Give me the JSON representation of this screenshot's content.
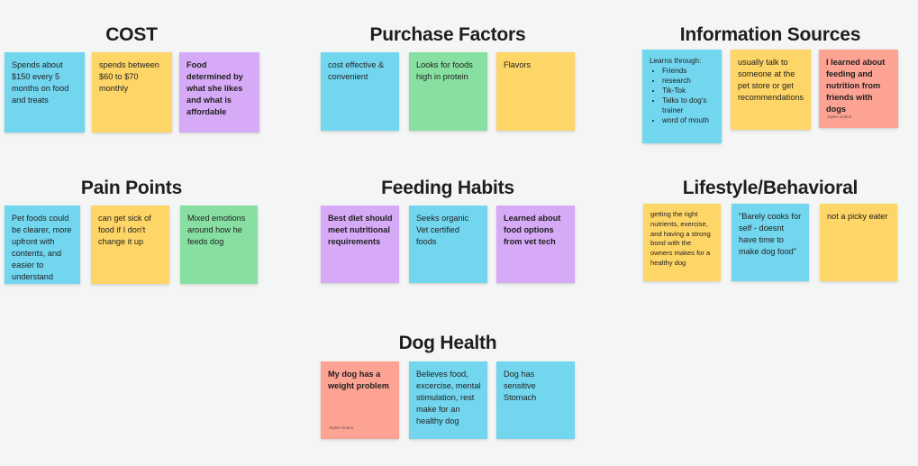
{
  "clusters": {
    "cost": {
      "title": "COST",
      "notes": [
        {
          "text": "Spends about $150 every 5 months on food and treats"
        },
        {
          "text": "spends between $60 to $70 monthly"
        },
        {
          "text": "Food determined by what she likes and what is affordable"
        }
      ]
    },
    "purchase_factors": {
      "title": "Purchase Factors",
      "notes": [
        {
          "text": "cost effective & convenient"
        },
        {
          "text": "Looks for foods high in protein"
        },
        {
          "text": "Flavors"
        }
      ]
    },
    "information_sources": {
      "title": "Information Sources",
      "notes": [
        {
          "intro": "Learns through:",
          "items": [
            "Friends",
            "research",
            "Tik-Tok",
            "Talks to dog's trainer",
            "word of mouth"
          ]
        },
        {
          "text": "usually talk to someone at the pet store or get recommendations"
        },
        {
          "text": "I learned about feeding and nutrition from friends with dogs",
          "author": "Jaylen Sutton"
        }
      ]
    },
    "pain_points": {
      "title": "Pain Points",
      "notes": [
        {
          "text": "Pet foods could be clearer, more upfront with contents, and easier to understand"
        },
        {
          "text": "can get sick of food if I don't change it up"
        },
        {
          "text": "Mixed emotions around how he feeds dog"
        }
      ]
    },
    "feeding_habits": {
      "title": "Feeding Habits",
      "notes": [
        {
          "text": "Best diet should meet nutritional requirements"
        },
        {
          "text": "Seeks organic Vet certified foods"
        },
        {
          "text": "Learned about food options from vet tech"
        }
      ]
    },
    "lifestyle": {
      "title": "Lifestyle/Behavioral",
      "notes": [
        {
          "text": "getting the right nutrients, exercise, and having a strong bond with the owners makes for a healthy dog"
        },
        {
          "text": "\"Barely cooks for self - doesnt have time to make dog food\""
        },
        {
          "text": "not a picky eater"
        }
      ]
    },
    "dog_health": {
      "title": "Dog Health",
      "notes": [
        {
          "text": "My dog has a weight problem",
          "author": "Jaylen Sutton"
        },
        {
          "text": "Believes food, excercise, mental stimulation, rest make for an healthy dog"
        },
        {
          "text": "Dog has sensitive Stomach"
        }
      ]
    }
  },
  "colors": {
    "blue": "#72d6ef",
    "yellow": "#fed567",
    "purple": "#d6aaf7",
    "green": "#87e0a1",
    "red": "#fda393",
    "background": "#f4f5f5"
  }
}
